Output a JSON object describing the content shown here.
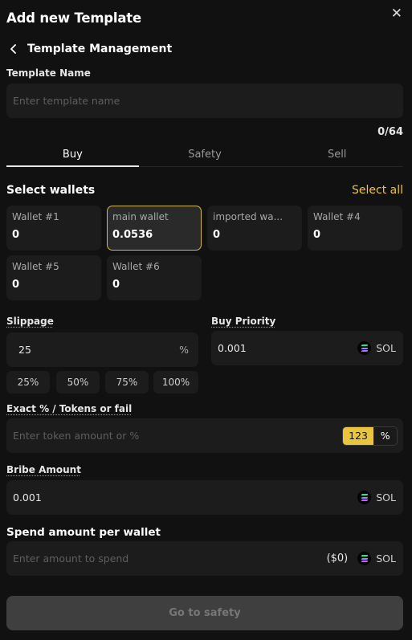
{
  "modal": {
    "title": "Add new Template",
    "close_glyph": "✕",
    "back_title": "Template Management"
  },
  "template_name": {
    "label": "Template Name",
    "placeholder": "Enter template name",
    "value": "",
    "counter": "0/64"
  },
  "tabs": [
    {
      "label": "Buy",
      "active": true
    },
    {
      "label": "Safety",
      "active": false
    },
    {
      "label": "Sell",
      "active": false
    }
  ],
  "wallets_section": {
    "label": "Select wallets",
    "select_all": "Select all",
    "wallets": [
      {
        "name": "Wallet #1",
        "balance": "0",
        "selected": false
      },
      {
        "name": "main wallet",
        "balance": "0.0536",
        "selected": true
      },
      {
        "name": "imported wa...",
        "balance": "0",
        "selected": false
      },
      {
        "name": "Wallet #4",
        "balance": "0",
        "selected": false
      },
      {
        "name": "Wallet #5",
        "balance": "0",
        "selected": false
      },
      {
        "name": "Wallet #6",
        "balance": "0",
        "selected": false
      }
    ]
  },
  "slippage": {
    "label": "Slippage",
    "value": "25",
    "suffix": "%",
    "presets": [
      "25%",
      "50%",
      "75%",
      "100%"
    ]
  },
  "buy_priority": {
    "label": "Buy Priority",
    "value": "0.001",
    "unit": "SOL"
  },
  "exact": {
    "label": "Exact % / Tokens or fail",
    "placeholder": "Enter token amount or %",
    "value": "",
    "toggle_on": "123",
    "toggle_off": "%"
  },
  "bribe": {
    "label": "Bribe Amount",
    "value": "0.001",
    "unit": "SOL"
  },
  "spend": {
    "label": "Spend amount per wallet",
    "placeholder": "Enter amount to spend",
    "value": "",
    "usd": "($0)",
    "unit": "SOL"
  },
  "primary_button": "Go to safety",
  "colors": {
    "accent": "#e9c43f",
    "background": "#111111",
    "field": "#1c1c1c",
    "disabled_button": "#3f3f3f"
  },
  "icons": {
    "close": "close-icon",
    "back": "chevron-left-icon",
    "currency": "solana-icon"
  }
}
